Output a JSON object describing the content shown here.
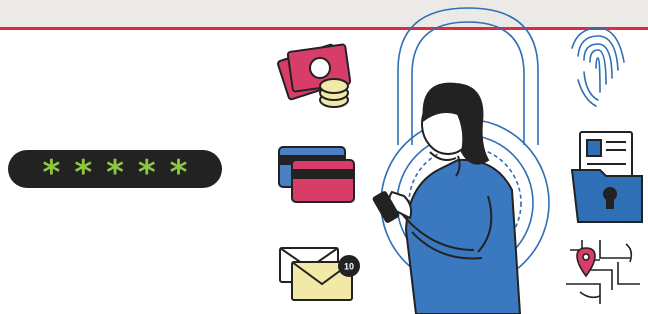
{
  "password_field": {
    "masked_value": "*****"
  },
  "notification_badge": {
    "count": "10"
  },
  "colors": {
    "accent_red": "#e02a3f",
    "pill_bg": "#222222",
    "password_green": "#8dc63f",
    "lock_blue": "#2f6fb5",
    "card_pink": "#d83d6a",
    "coin_yellow": "#f3e9a6",
    "shirt_blue": "#3a78bf"
  },
  "icons": [
    "money-coins-icon",
    "credit-cards-icon",
    "mail-notification-icon",
    "fingerprint-icon",
    "id-folder-lock-icon",
    "map-location-icon",
    "padlock-icon"
  ]
}
